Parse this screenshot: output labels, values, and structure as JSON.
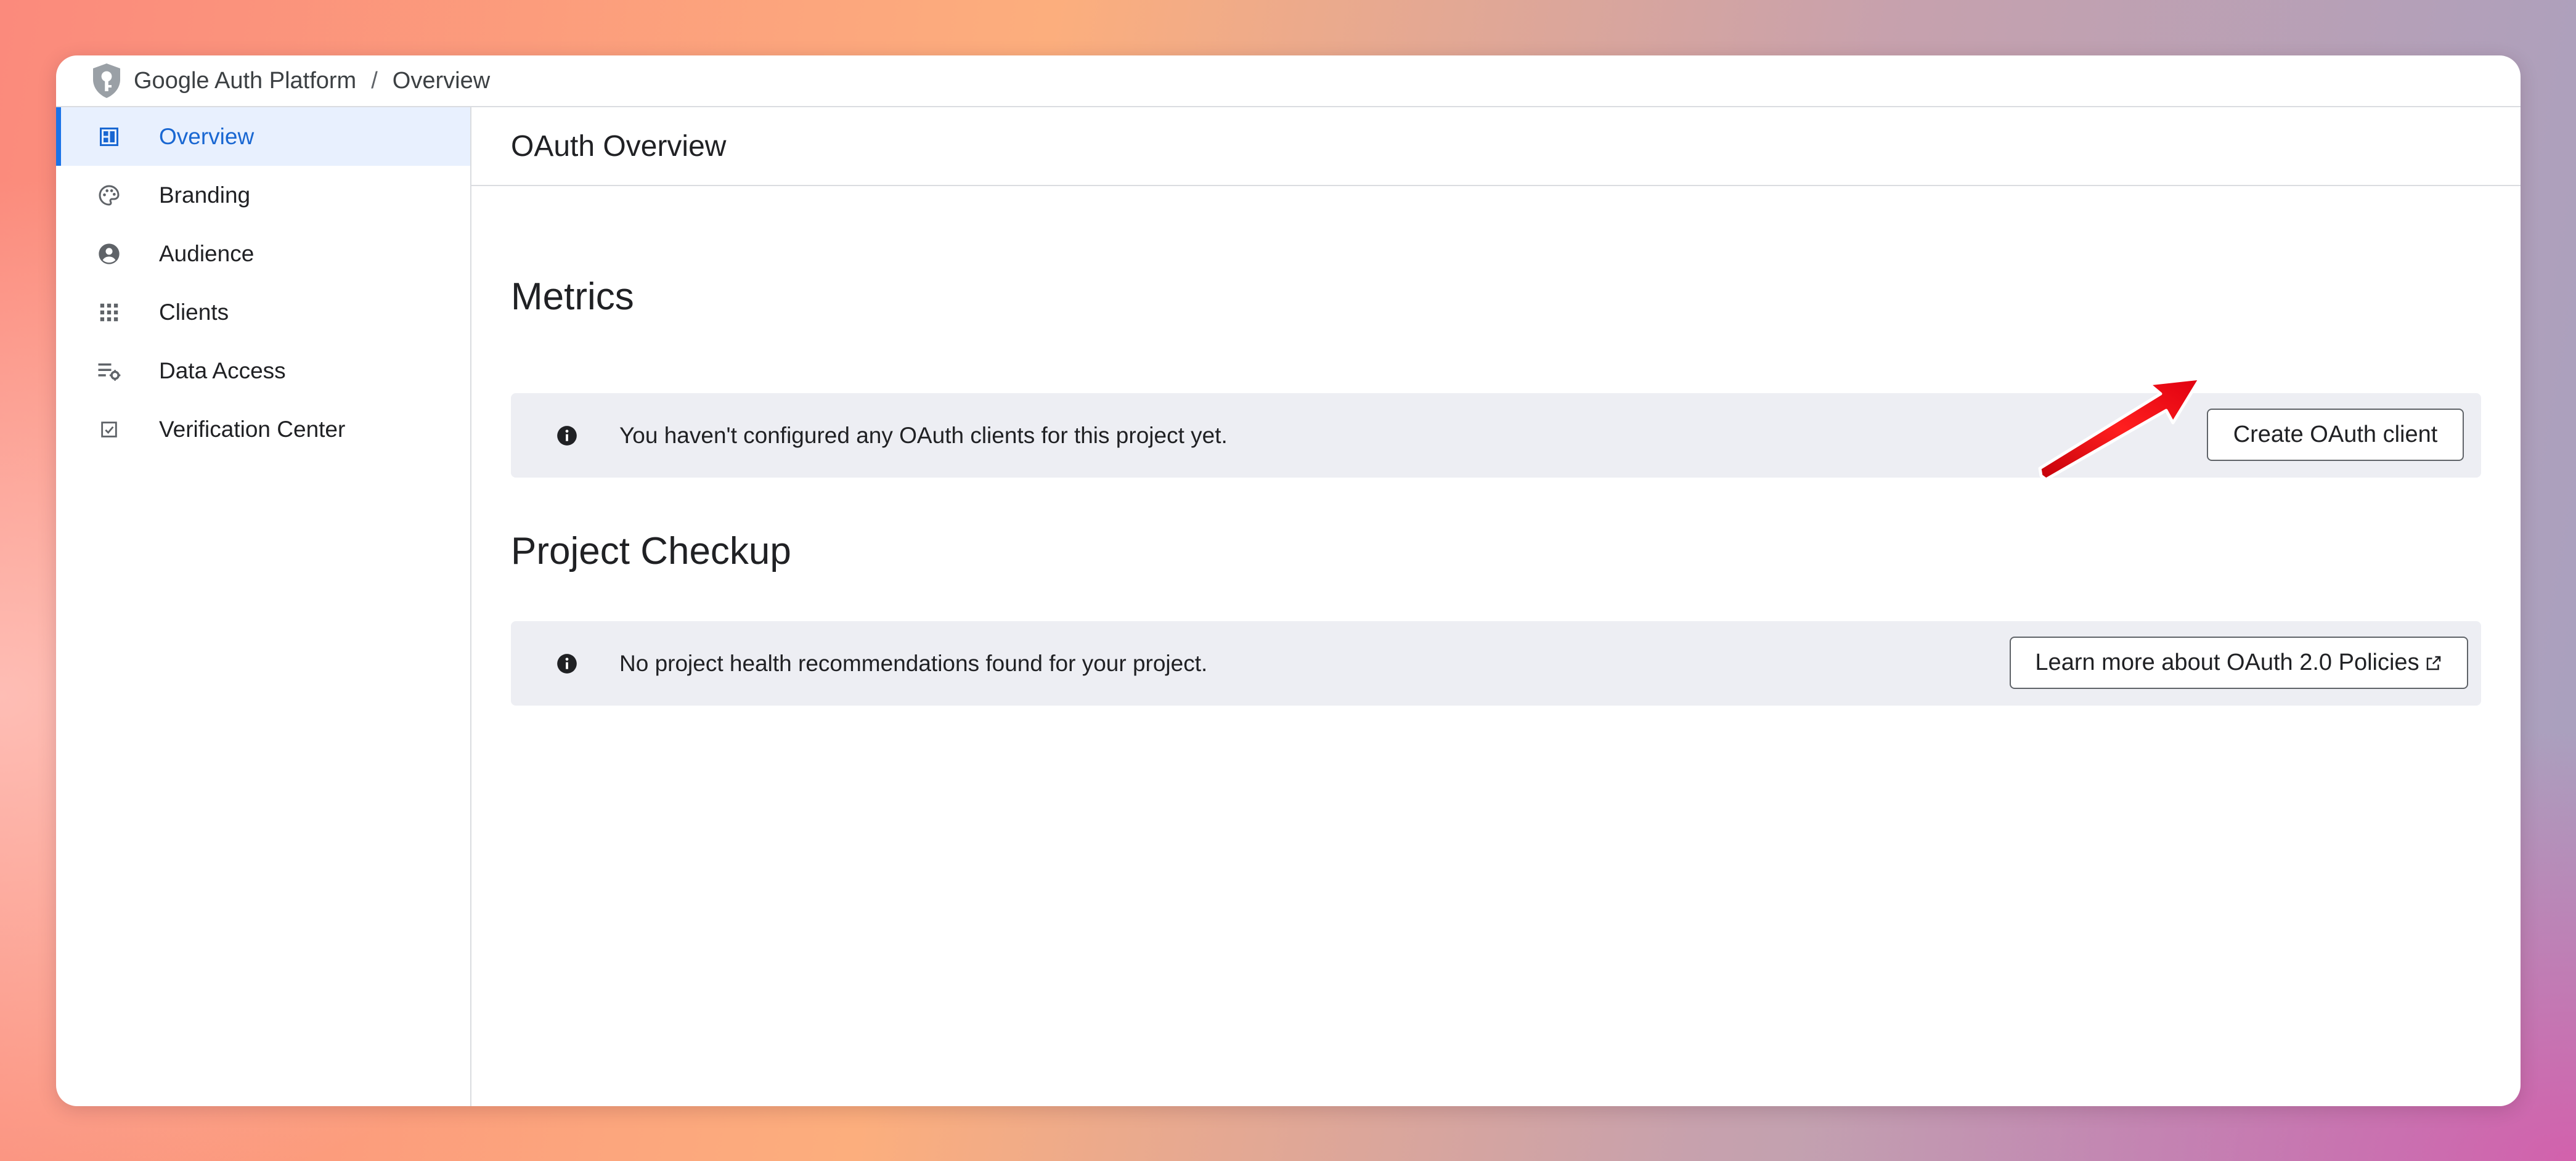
{
  "breadcrumb": {
    "app": "Google Auth Platform",
    "separator": "/",
    "current": "Overview"
  },
  "sidebar": {
    "items": [
      {
        "label": "Overview",
        "icon": "dashboard-icon",
        "active": true
      },
      {
        "label": "Branding",
        "icon": "palette-icon",
        "active": false
      },
      {
        "label": "Audience",
        "icon": "account-circle-icon",
        "active": false
      },
      {
        "label": "Clients",
        "icon": "apps-grid-icon",
        "active": false
      },
      {
        "label": "Data Access",
        "icon": "list-settings-icon",
        "active": false
      },
      {
        "label": "Verification Center",
        "icon": "checkbox-icon",
        "active": false
      }
    ]
  },
  "main": {
    "page_title": "OAuth Overview",
    "metrics": {
      "title": "Metrics",
      "message": "You haven't configured any OAuth clients for this project yet.",
      "button_label": "Create OAuth client"
    },
    "checkup": {
      "title": "Project Checkup",
      "message": "No project health recommendations found for your project.",
      "button_label": "Learn more about OAuth 2.0 Policies"
    }
  },
  "colors": {
    "accent": "#1a73e8",
    "active_bg": "#e8f0fe",
    "banner_bg": "#edeef3",
    "annotation_arrow": "#e8101a"
  }
}
